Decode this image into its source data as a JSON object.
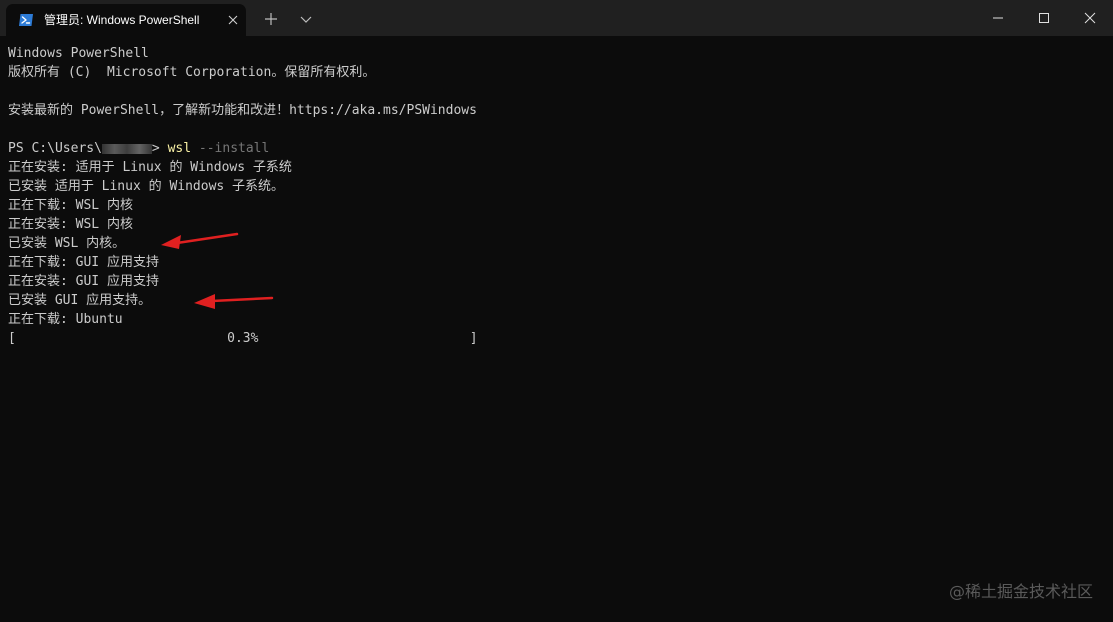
{
  "window": {
    "tab_title": "管理员: Windows PowerShell",
    "icons": {
      "tab_icon": "powershell-icon",
      "tab_close": "close-icon",
      "new_tab": "plus-icon",
      "dropdown": "chevron-down-icon",
      "minimize": "minimize-icon",
      "maximize": "maximize-icon",
      "close": "close-icon"
    }
  },
  "terminal": {
    "banner": {
      "line1": "Windows PowerShell",
      "line2": "版权所有 (C)  Microsoft Corporation。保留所有权利。",
      "line3": "安装最新的 PowerShell，了解新功能和改进！https://aka.ms/PSWindows"
    },
    "prompt": {
      "prefix": "PS C:\\Users\\",
      "suffix": "> ",
      "command": "wsl",
      "argument": " --install"
    },
    "output": [
      "正在安装: 适用于 Linux 的 Windows 子系统",
      "已安装 适用于 Linux 的 Windows 子系统。",
      "正在下载: WSL 内核",
      "正在安装: WSL 内核",
      "已安装 WSL 内核。",
      "正在下载: GUI 应用支持",
      "正在安装: GUI 应用支持",
      "已安装 GUI 应用支持。",
      "正在下载: Ubuntu"
    ],
    "progress": {
      "open_bracket": "[",
      "percent_label": "0.3%",
      "close_bracket": "]",
      "value": 0.003
    }
  },
  "colors": {
    "background": "#0c0c0c",
    "titlebar": "#202020",
    "text": "#cccccc",
    "command": "#f9f1a5",
    "argument": "#767676",
    "annotation_arrow": "#e02020"
  },
  "watermark": "@稀土掘金技术社区"
}
